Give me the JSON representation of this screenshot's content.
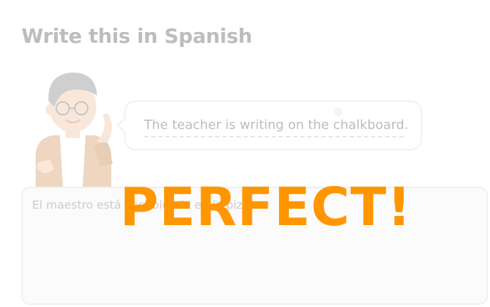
{
  "header": {
    "title": "Write this in Spanish"
  },
  "prompt": {
    "sentence": "The teacher is writing on the chalkboard."
  },
  "answer": {
    "value": "El maestro está escribiendo en la pizarra."
  },
  "feedback": {
    "banner": "PERFECT!"
  },
  "colors": {
    "banner": "#ff9600",
    "heading": "#bdbdbd",
    "prompt_text": "#bcbcbc"
  },
  "icons": {
    "character": "teacher-character-icon"
  }
}
